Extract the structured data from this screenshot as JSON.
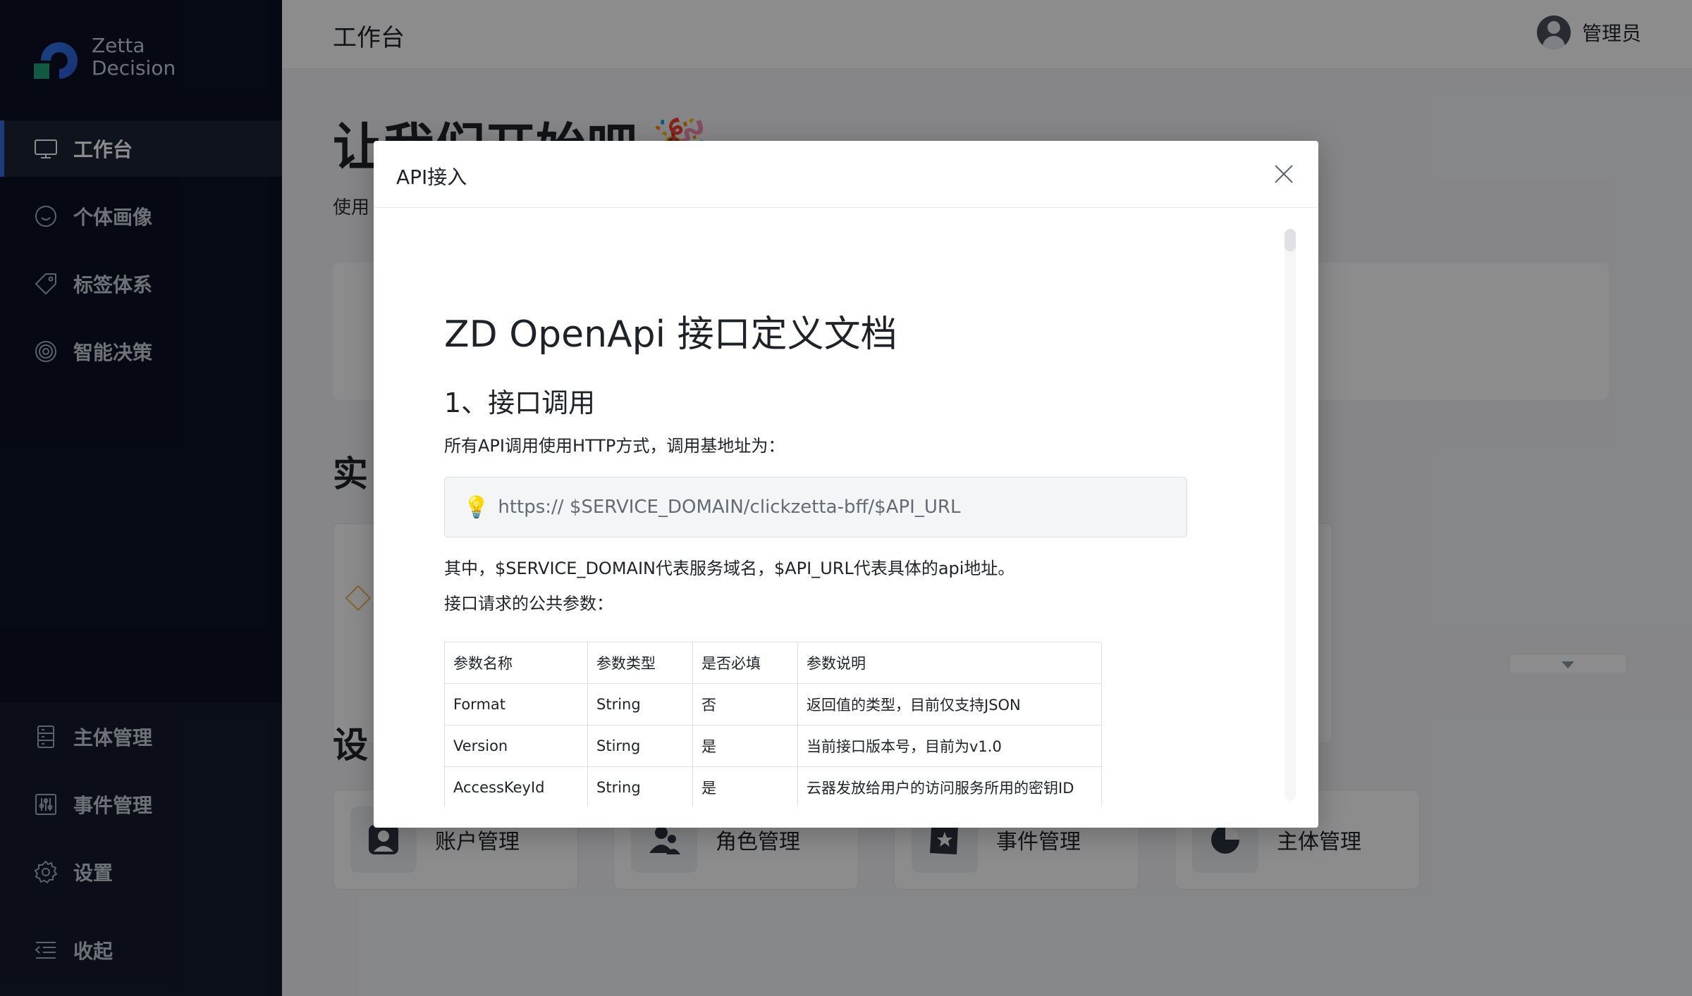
{
  "sidebar": {
    "brand": {
      "line1": "Zetta",
      "line2": "Decision"
    },
    "items": [
      {
        "label": "工作台",
        "icon": "monitor-icon"
      },
      {
        "label": "个体画像",
        "icon": "smile-icon"
      },
      {
        "label": "标签体系",
        "icon": "tag-icon"
      },
      {
        "label": "智能决策",
        "icon": "target-icon"
      }
    ],
    "bottom_items": [
      {
        "label": "主体管理",
        "icon": "database-icon"
      },
      {
        "label": "事件管理",
        "icon": "sliders-icon"
      },
      {
        "label": "设置",
        "icon": "gear-icon"
      },
      {
        "label": "收起",
        "icon": "collapse-icon"
      }
    ]
  },
  "header": {
    "title": "工作台",
    "user": "管理员"
  },
  "main": {
    "welcome": "让我们开始吧",
    "welcome_sub": "使用",
    "practice_title": "实",
    "settings_title": "设",
    "setting_cards": [
      {
        "label": "账户管理",
        "icon": "account-icon"
      },
      {
        "label": "角色管理",
        "icon": "users-icon"
      },
      {
        "label": "事件管理",
        "icon": "event-star-icon"
      },
      {
        "label": "主体管理",
        "icon": "pie-chart-icon"
      }
    ]
  },
  "modal": {
    "title": "API接入",
    "doc": {
      "h1": "ZD OpenApi 接口定义文档",
      "h2": "1、接口调用",
      "intro": "所有API调用使用HTTP方式，调用基地址为：",
      "base_url": "https:// $SERVICE_DOMAIN/clickzetta-bff/$API_URL",
      "explain": "其中，$SERVICE_DOMAIN代表服务域名，$API_URL代表具体的api地址。",
      "params_title": "接口请求的公共参数：",
      "table_headers": [
        "参数名称",
        "参数类型",
        "是否必填",
        "参数说明"
      ],
      "table_rows": [
        [
          "Format",
          "String",
          "否",
          "返回值的类型，目前仅支持JSON"
        ],
        [
          "Version",
          "Stirng",
          "是",
          "当前接口版本号，目前为v1.0"
        ],
        [
          "AccessKeyId",
          "String",
          "是",
          "云器发放给用户的访问服务所用的密钥ID"
        ]
      ]
    }
  },
  "colors": {
    "accent": "#3a6ae0",
    "sidebar_bg": "#0b1224",
    "overlay": "rgba(0,0,0,0.45)"
  }
}
